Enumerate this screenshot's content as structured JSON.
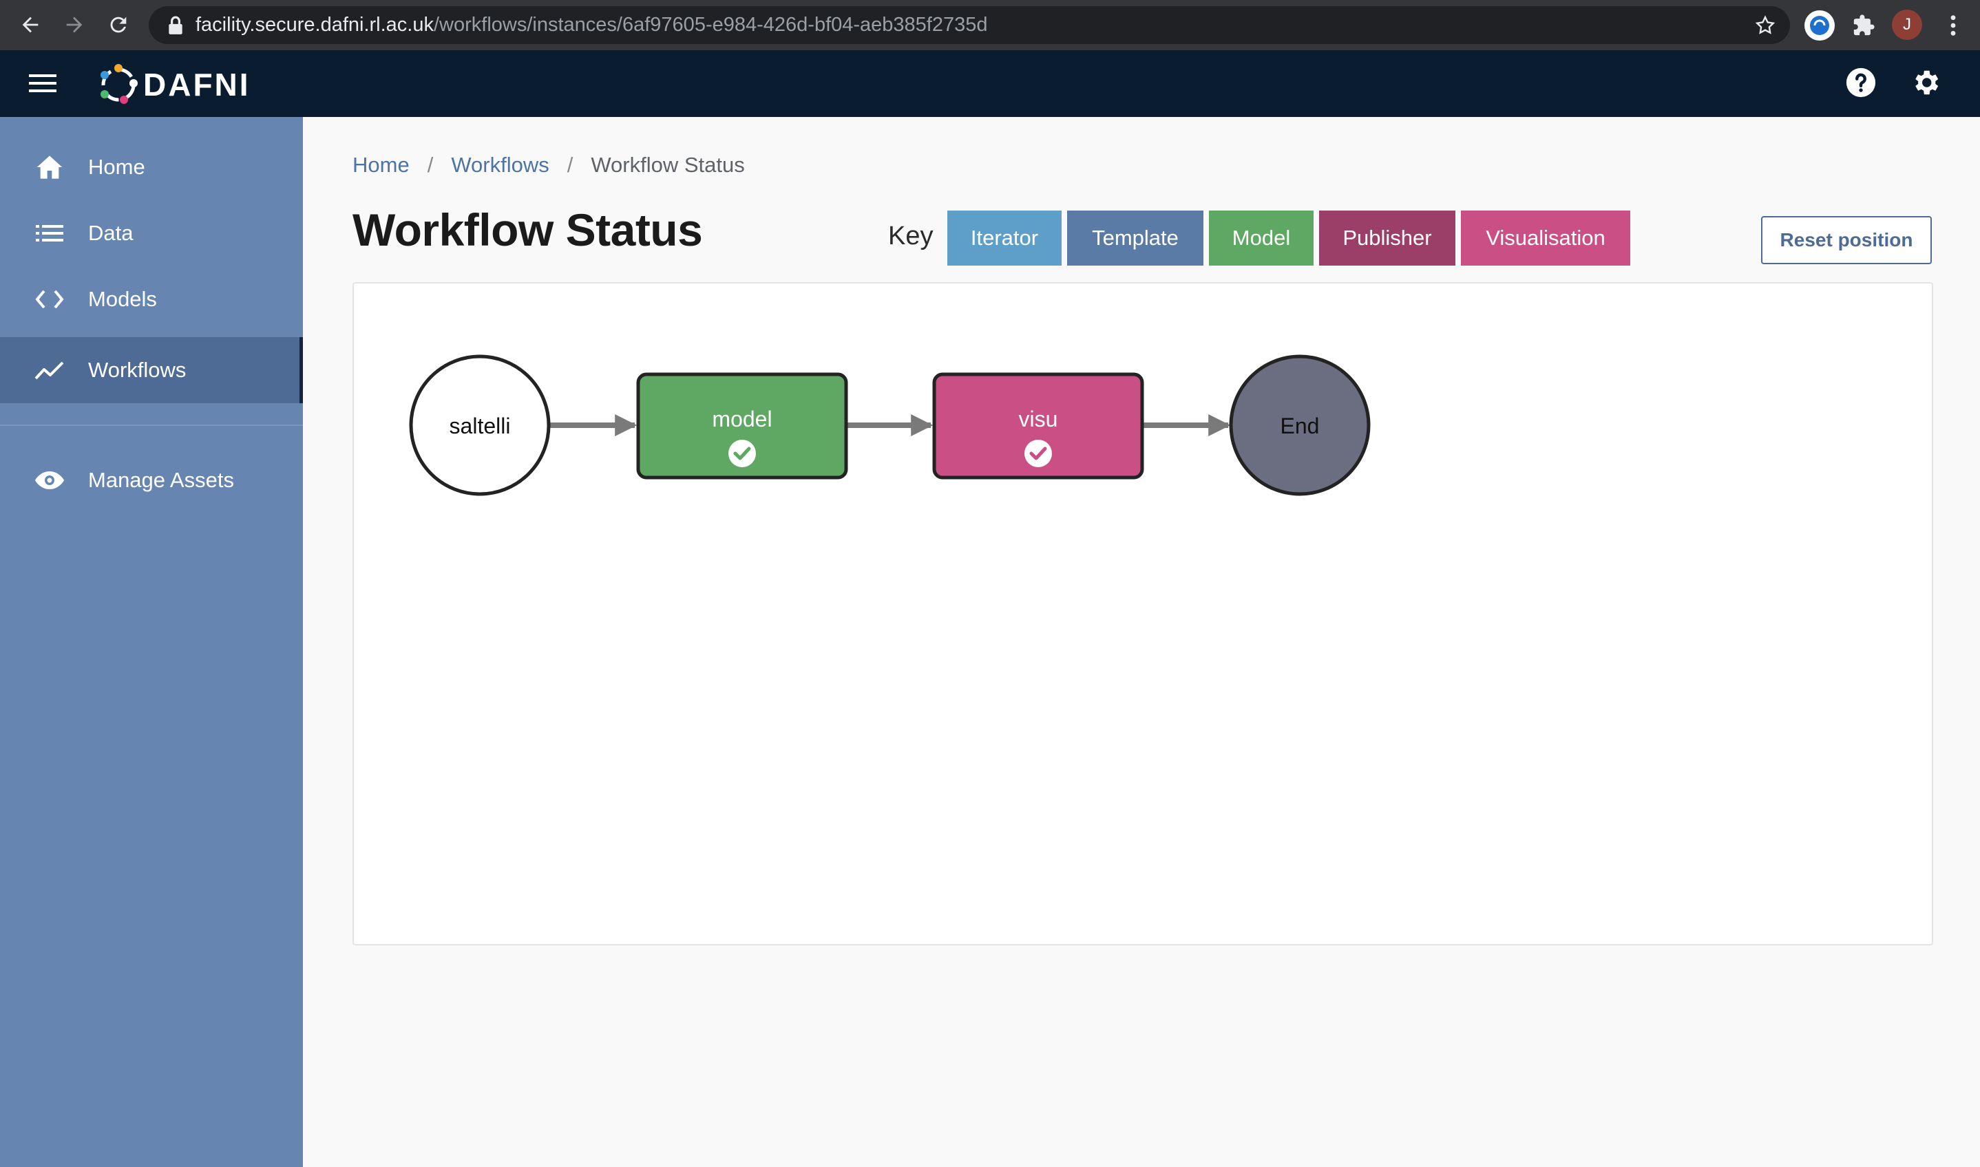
{
  "browser": {
    "url_host": "facility.secure.dafni.rl.ac.uk",
    "url_path": "/workflows/instances/6af97605-e984-426d-bf04-aeb385f2735d",
    "profile_initial": "J"
  },
  "header": {
    "logo_text": "DAFNI",
    "icons": [
      "menu-icon",
      "help-icon",
      "gear-icon"
    ]
  },
  "sidebar": {
    "items": [
      {
        "label": "Home",
        "icon": "home-icon"
      },
      {
        "label": "Data",
        "icon": "list-icon"
      },
      {
        "label": "Models",
        "icon": "code-icon"
      },
      {
        "label": "Workflows",
        "icon": "trend-icon",
        "active": true
      },
      {
        "label": "Manage Assets",
        "icon": "eye-icon"
      }
    ]
  },
  "breadcrumb": {
    "home": "Home",
    "workflows": "Workflows",
    "current": "Workflow Status",
    "separator": "/"
  },
  "page": {
    "title": "Workflow Status",
    "key_label": "Key",
    "reset_label": "Reset position"
  },
  "key": [
    {
      "label": "Iterator",
      "color": "#5e9fca"
    },
    {
      "label": "Template",
      "color": "#5b7ba7"
    },
    {
      "label": "Model",
      "color": "#5ea863"
    },
    {
      "label": "Publisher",
      "color": "#9c3f68"
    },
    {
      "label": "Visualisation",
      "color": "#c94f84"
    }
  ],
  "workflow": {
    "nodes": [
      {
        "label": "saltelli",
        "kind": "start",
        "color": "#ffffff"
      },
      {
        "label": "model",
        "kind": "model",
        "color": "#5ea863",
        "status": "check-circle-icon"
      },
      {
        "label": "visu",
        "kind": "visualisation",
        "color": "#c94f84",
        "status": "check-circle-icon"
      },
      {
        "label": "End",
        "kind": "end",
        "color": "#6b6d80"
      }
    ]
  }
}
